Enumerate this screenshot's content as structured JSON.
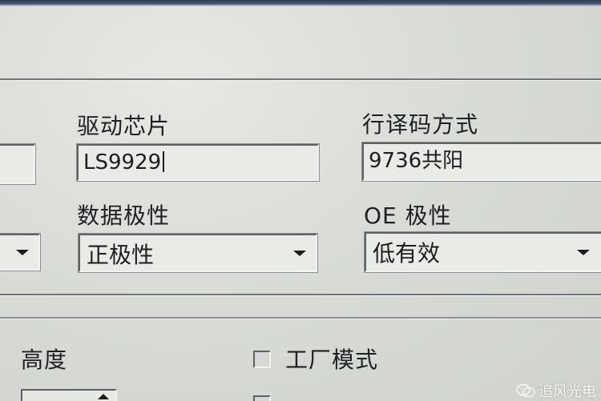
{
  "form": {
    "driver_chip": {
      "label": "驱动芯片",
      "value": "LS9929"
    },
    "row_decoding": {
      "label": "行译码方式",
      "value": "9736共阳"
    },
    "data_polarity": {
      "label": "数据极性",
      "value": "正极性"
    },
    "oe_polarity": {
      "label": "OE 极性",
      "value": "低有效"
    },
    "height": {
      "label": "高度"
    },
    "factory_mode": {
      "label": "工厂模式"
    }
  },
  "watermark": {
    "text": "追风光电",
    "icon": "wechat-icon"
  },
  "colors": {
    "background": "#d8dbd6",
    "text": "#1f2225",
    "window_edge": "#2c3a54"
  }
}
